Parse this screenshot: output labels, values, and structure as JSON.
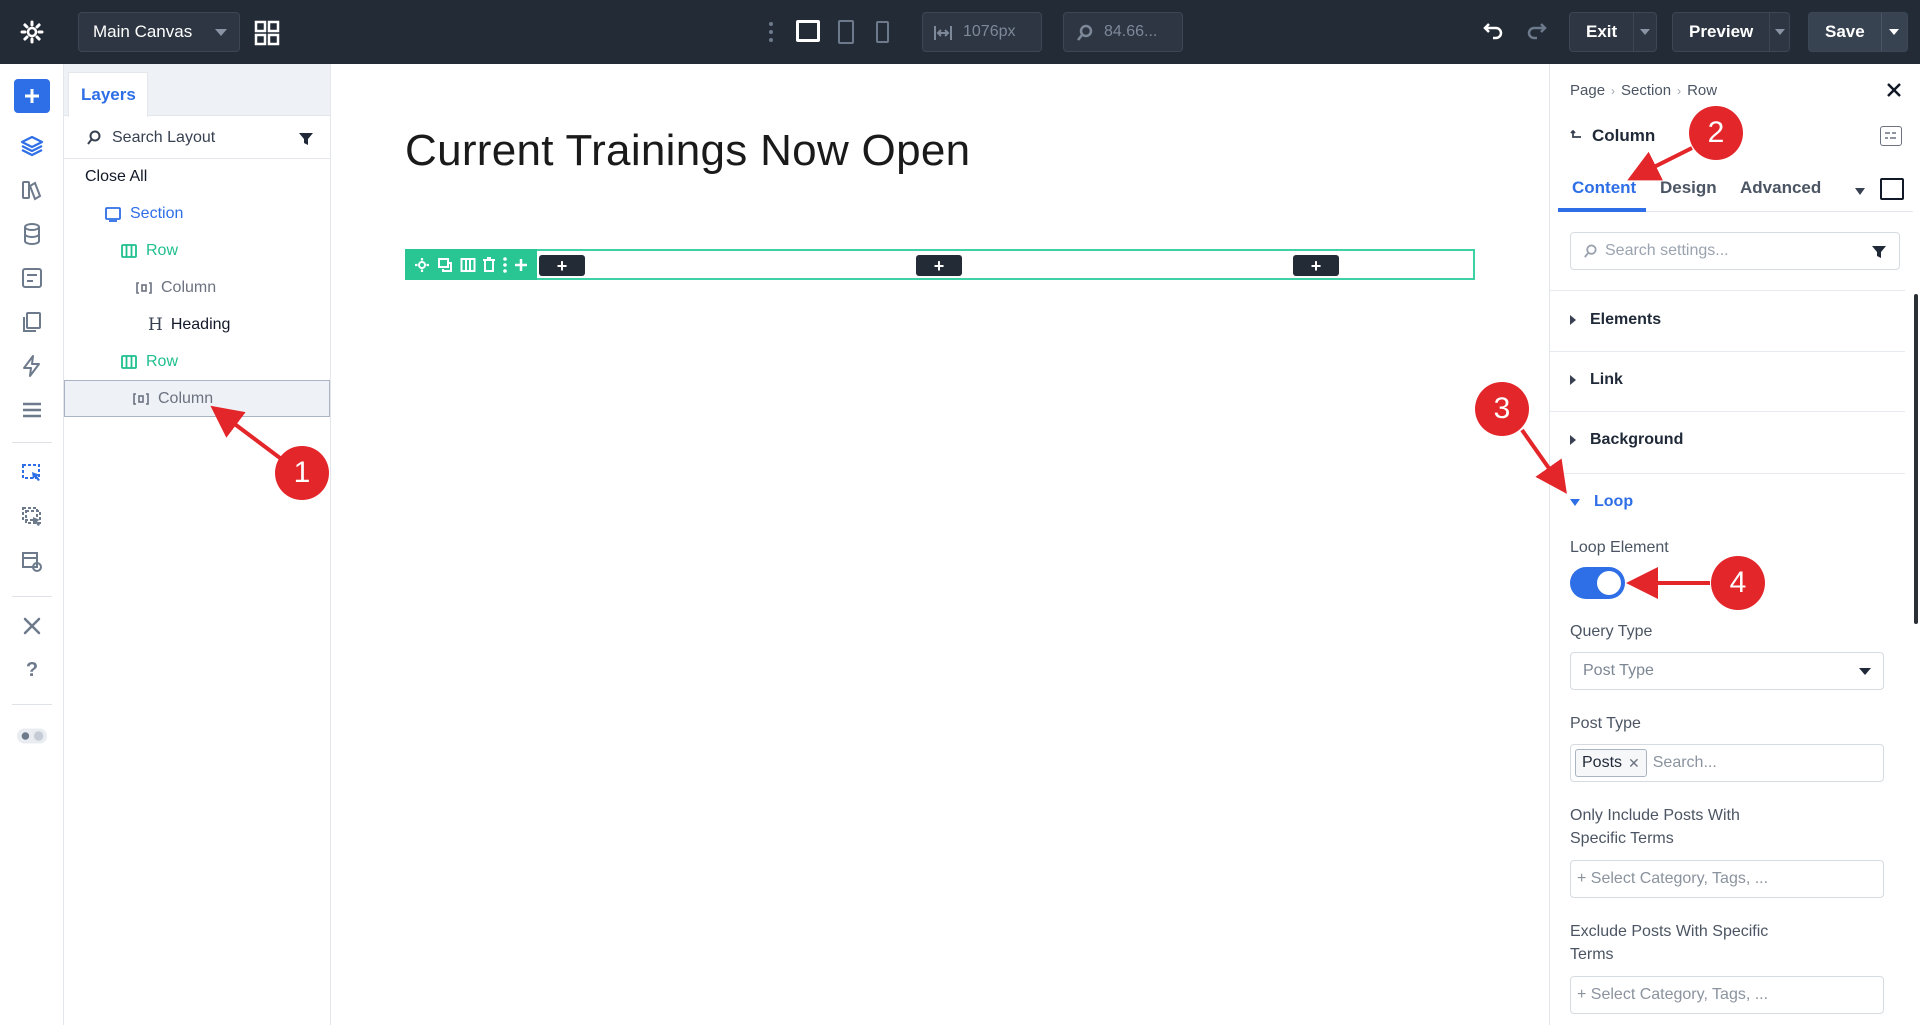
{
  "topbar": {
    "canvas_name": "Main Canvas",
    "width_value": "1076px",
    "zoom_value": "84.66...",
    "exit_label": "Exit",
    "preview_label": "Preview",
    "save_label": "Save"
  },
  "layers": {
    "tab_label": "Layers",
    "search_placeholder": "Search Layout",
    "close_all": "Close All",
    "tree": [
      {
        "label": "Section",
        "type": "section"
      },
      {
        "label": "Row",
        "type": "row"
      },
      {
        "label": "Column",
        "type": "column"
      },
      {
        "label": "Heading",
        "type": "heading"
      },
      {
        "label": "Row",
        "type": "row"
      },
      {
        "label": "Column",
        "type": "column",
        "selected": true
      }
    ]
  },
  "canvas": {
    "heading": "Current Trainings Now Open",
    "add_labels": [
      "+",
      "+",
      "+"
    ]
  },
  "settings": {
    "breadcrumb": [
      "Page",
      "Section",
      "Row"
    ],
    "title": "Column",
    "tabs": [
      "Content",
      "Design",
      "Advanced"
    ],
    "active_tab": "Content",
    "search_placeholder": "Search settings...",
    "groups": [
      "Elements",
      "Link",
      "Background",
      "Loop"
    ],
    "open_group": "Loop",
    "loop_element_label": "Loop Element",
    "loop_element_enabled": true,
    "query_type_label": "Query Type",
    "query_type_value": "Post Type",
    "post_type_label": "Post Type",
    "post_type_tag": "Posts",
    "post_type_search": "Search...",
    "include_terms_label_1": "Only Include Posts With",
    "include_terms_label_2": "Specific Terms",
    "include_terms_placeholder": "+ Select Category, Tags, ...",
    "exclude_terms_label_1": "Exclude Posts With Specific",
    "exclude_terms_label_2": "Terms",
    "exclude_terms_placeholder": "+ Select Category, Tags, ..."
  },
  "annotations": [
    "1",
    "2",
    "3",
    "4"
  ],
  "colors": {
    "topbar_bg": "#232b36",
    "accent_blue": "#2e6ee6",
    "row_green": "#1fbf8e",
    "annotation_red": "#e3262a"
  }
}
